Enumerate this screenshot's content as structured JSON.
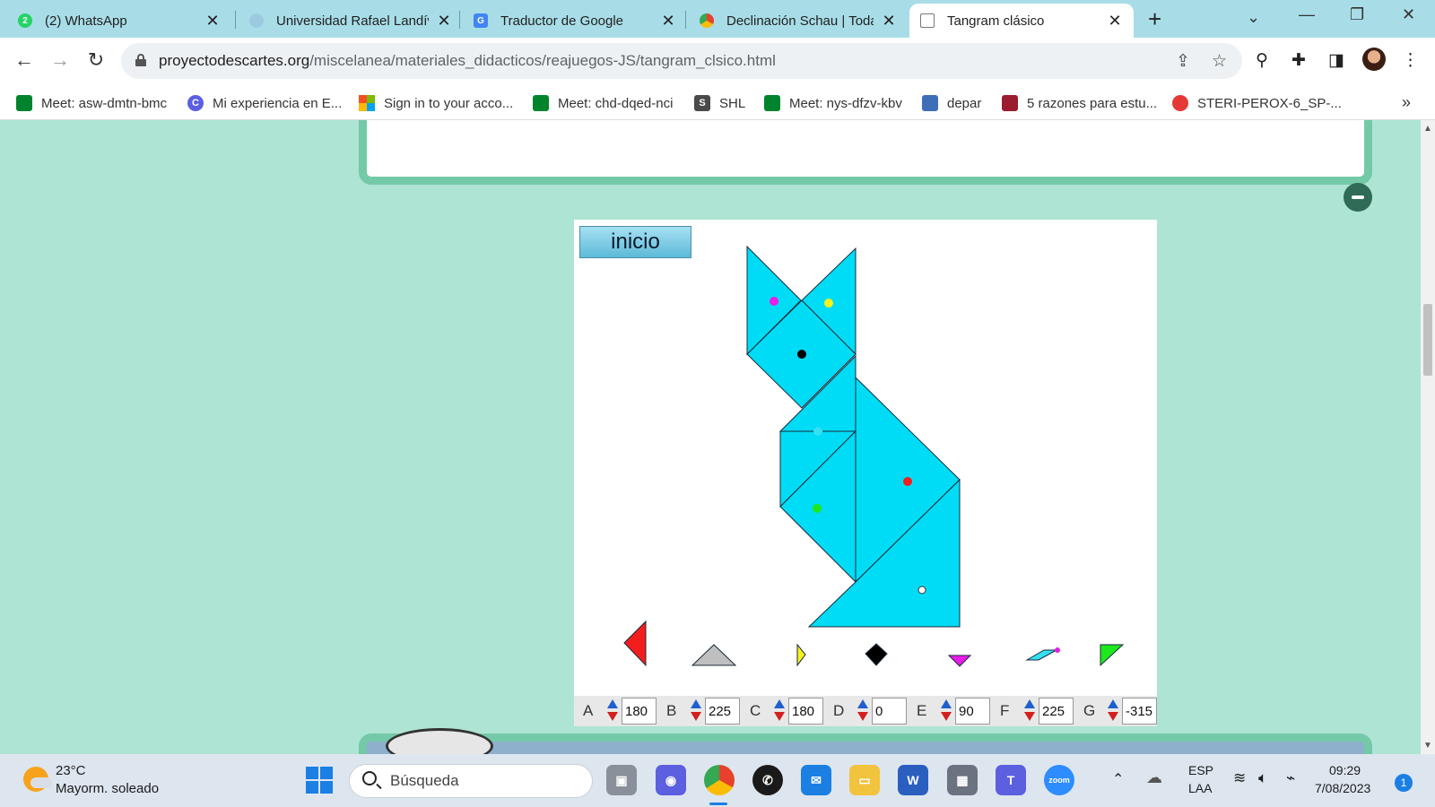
{
  "browser": {
    "tabs": [
      {
        "title": "(2) WhatsApp",
        "icon": "whatsapp-icon",
        "color": "#25d366",
        "badge": "2"
      },
      {
        "title": "Universidad Rafael Landív",
        "icon": "globe-icon",
        "color": "#9ccbe0"
      },
      {
        "title": "Traductor de Google",
        "icon": "google-translate-icon",
        "color": "#4285f4"
      },
      {
        "title": "Declinación Schau | Todas",
        "icon": "chrome-icon",
        "color": "#e8412b"
      },
      {
        "title": "Tangram clásico",
        "icon": "page-icon",
        "color": "#777777",
        "active": true
      }
    ],
    "url_domain": "proyectodescartes.org",
    "url_path": "/miscelanea/materiales_didacticos/reajuegos-JS/tangram_clsico.html",
    "bookmarks": [
      {
        "label": "Meet: asw-dmtn-bmc",
        "icon": "google-meet-icon",
        "color": "#00832d"
      },
      {
        "label": "Mi experiencia en E...",
        "icon": "letter-c-icon",
        "color": "#5b5fe0",
        "letter": "C"
      },
      {
        "label": "Sign in to your acco...",
        "icon": "microsoft-icon",
        "color": "#f25022"
      },
      {
        "label": "Meet: chd-dqed-nci",
        "icon": "google-meet-icon",
        "color": "#00832d"
      },
      {
        "label": "SHL",
        "icon": "letter-s-icon",
        "color": "#4a4a4a",
        "letter": "S"
      },
      {
        "label": "Meet: nys-dfzv-kbv",
        "icon": "google-meet-icon",
        "color": "#00832d"
      },
      {
        "label": "depar",
        "icon": "document-icon",
        "color": "#3d6fb6"
      },
      {
        "label": "5 razones para estu...",
        "icon": "university-icon",
        "color": "#9b1b2f"
      },
      {
        "label": "STERI-PEROX-6_SP-...",
        "icon": "red-circle-icon",
        "color": "#e53935"
      }
    ]
  },
  "tangram": {
    "start_button": "inicio",
    "colors": {
      "piece_fill": "#00dcf5",
      "red": "#f21d1d",
      "gray": "#bfbfbf",
      "yellow": "#f7f21d",
      "black": "#000000",
      "magenta": "#e81be8",
      "cyan": "#33e1f2",
      "green": "#1ce81c"
    },
    "controls": [
      {
        "label": "A",
        "value": "180"
      },
      {
        "label": "B",
        "value": "225"
      },
      {
        "label": "C",
        "value": "180"
      },
      {
        "label": "D",
        "value": "0"
      },
      {
        "label": "E",
        "value": "90"
      },
      {
        "label": "F",
        "value": "225"
      },
      {
        "label": "G",
        "value": "-315"
      }
    ]
  },
  "taskbar": {
    "temperature": "23°C",
    "weather": "Mayorm. soleado",
    "search_placeholder": "Búsqueda",
    "language_line1": "ESP",
    "language_line2": "LAA",
    "time": "09:29",
    "date": "7/08/2023",
    "notifications": "1"
  }
}
